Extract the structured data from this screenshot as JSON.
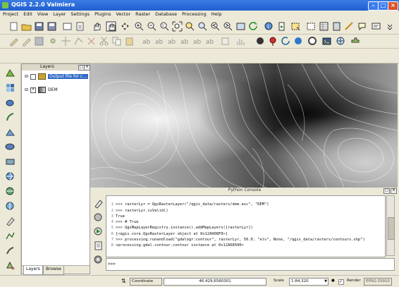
{
  "window": {
    "title": "QGIS 2.2.0 Valmiera",
    "controls": [
      "minimize-icon",
      "maximize-icon",
      "close-icon"
    ]
  },
  "menu": [
    "Project",
    "Edit",
    "View",
    "Layer",
    "Settings",
    "Plugins",
    "Vector",
    "Raster",
    "Database",
    "Processing",
    "Help"
  ],
  "layers_panel": {
    "title": "Layers",
    "layers": [
      {
        "name": "Output file for c...",
        "checked": false
      },
      {
        "name": "DEM",
        "checked": true
      }
    ],
    "tabs": [
      "Layers",
      "Browse"
    ]
  },
  "console": {
    "title": "Python Console",
    "lines": [
      {
        "n": "1",
        "text": ">>> rasterLyr = QgsRasterLayer(\"/qgis_data/rasters/dem.asc\", \"DEM\")"
      },
      {
        "n": "2",
        "text": ">>> rasterLyr.isValid()"
      },
      {
        "n": "3",
        "text": "True"
      },
      {
        "n": "4",
        "text": ">>> # True"
      },
      {
        "n": "5",
        "text": ">>> QgsMapLayerRegistry.instance().addMapLayers([rasterLyr])"
      },
      {
        "n": "6",
        "text": "[<qgis.core.QgsRasterLayer object at 0x12A908F0>]"
      },
      {
        "n": "7",
        "text": ">>> processing.runandload(\"gdalogr:contour\", rasterLyr, 50.0, \"elv\", None, \"/qgis_data/rasters/contours.shp\")"
      },
      {
        "n": "8",
        "text": "<processing.gdal.contour.contour instance at 0x12A68500>"
      }
    ],
    "prompt": ">>>"
  },
  "status": {
    "coordinate_label": "Coordinate",
    "coordinate_value": "46.429,6580301",
    "scale_label": "Scale",
    "scale_value": "1:84,320",
    "render_label": "Render",
    "render_checked": true,
    "crs": "EPSG:25910"
  }
}
